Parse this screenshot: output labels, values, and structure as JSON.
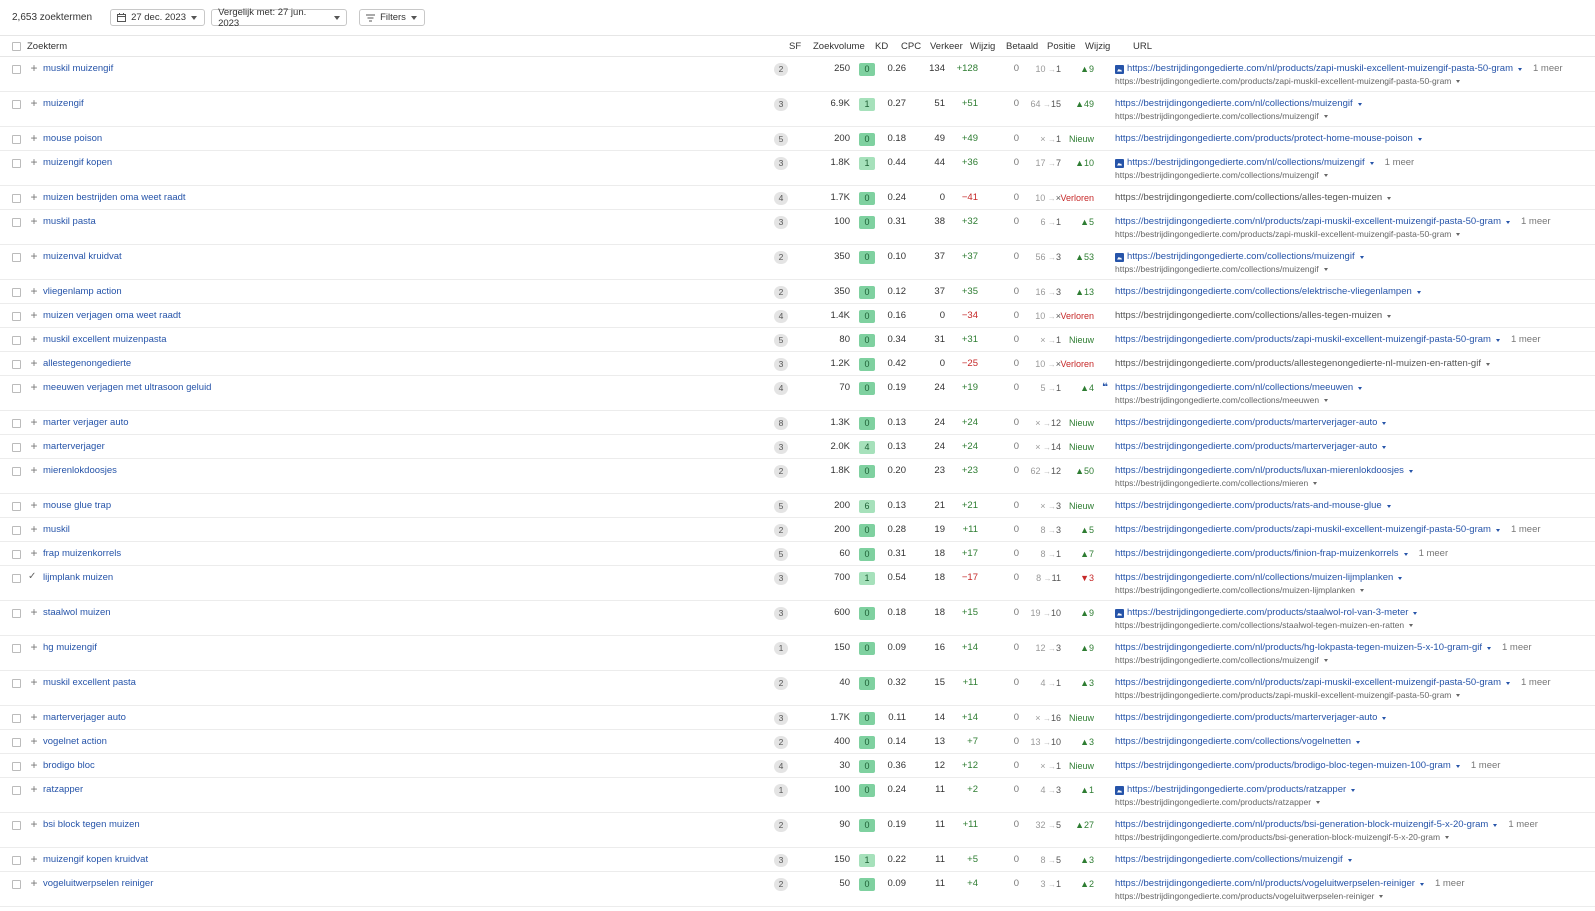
{
  "toolbar": {
    "count": "2,653 zoektermen",
    "date_label": "27 dec. 2023",
    "compare_label": "Vergelijk met: 27 jun. 2023",
    "filters_label": "Filters"
  },
  "table": {
    "headers": {
      "keyword": "Zoekterm",
      "sf": "SF",
      "volume": "Zoekvolume",
      "kd": "KD",
      "cpc": "CPC",
      "traffic": "Verkeer",
      "change": "Wijzig",
      "paid": "Betaald",
      "position": "Positie",
      "pos_change": "Wijzig",
      "url": "URL"
    },
    "more_label": "1 meer",
    "colors": {
      "kd_green": "#7fd1a0",
      "kd_light": "#a6e1bb",
      "link": "#2654a9",
      "up": "#2e7d32",
      "down": "#c62828"
    },
    "rows": [
      {
        "kw": "muskil muizengif",
        "sf": "2",
        "vol": "250",
        "kd": "0",
        "cpc": "0.26",
        "trf": "134",
        "chg": "+128",
        "paid": "0",
        "p_old": "10",
        "p_new": "1",
        "pc": "▲9",
        "pct": "up",
        "url1": "https://bestrijdingongedierte.com/nl/products/zapi-muskil-excellent-muizengif-pasta-50-gram",
        "img": true,
        "more": true,
        "url2": "https://bestrijdingongedierte.com/products/zapi-muskil-excellent-muizengif-pasta-50-gram"
      },
      {
        "kw": "muizengif",
        "sf": "3",
        "vol": "6.9K",
        "kd": "1",
        "cpc": "0.27",
        "trf": "51",
        "chg": "+51",
        "paid": "0",
        "p_old": "64",
        "p_new": "15",
        "pc": "▲49",
        "pct": "up",
        "url1": "https://bestrijdingongedierte.com/nl/collections/muizengif",
        "url2": "https://bestrijdingongedierte.com/collections/muizengif"
      },
      {
        "kw": "mouse poison",
        "sf": "5",
        "vol": "200",
        "kd": "0",
        "cpc": "0.18",
        "trf": "49",
        "chg": "+49",
        "paid": "0",
        "p_old": "×",
        "p_new": "1",
        "pc": "Nieuw",
        "pct": "up",
        "url1": "https://bestrijdingongedierte.com/products/protect-home-mouse-poison"
      },
      {
        "kw": "muizengif kopen",
        "sf": "3",
        "vol": "1.8K",
        "kd": "1",
        "cpc": "0.44",
        "trf": "44",
        "chg": "+36",
        "paid": "0",
        "p_old": "17",
        "p_new": "7",
        "pc": "▲10",
        "pct": "up",
        "url1": "https://bestrijdingongedierte.com/nl/collections/muizengif",
        "img": true,
        "more": true,
        "url2": "https://bestrijdingongedierte.com/collections/muizengif"
      },
      {
        "kw": "muizen bestrijden oma weet raadt",
        "sf": "4",
        "vol": "1.7K",
        "kd": "0",
        "cpc": "0.24",
        "trf": "0",
        "chg": "−41",
        "paid": "0",
        "p_old": "10",
        "p_new": "×",
        "pc": "Verloren",
        "pct": "down",
        "url1": "https://bestrijdingongedierte.com/collections/alles-tegen-muizen",
        "grey": true
      },
      {
        "kw": "muskil pasta",
        "sf": "3",
        "vol": "100",
        "kd": "0",
        "cpc": "0.31",
        "trf": "38",
        "chg": "+32",
        "paid": "0",
        "p_old": "6",
        "p_new": "1",
        "pc": "▲5",
        "pct": "up",
        "url1": "https://bestrijdingongedierte.com/nl/products/zapi-muskil-excellent-muizengif-pasta-50-gram",
        "more": true,
        "url2": "https://bestrijdingongedierte.com/products/zapi-muskil-excellent-muizengif-pasta-50-gram"
      },
      {
        "kw": "muizenval kruidvat",
        "sf": "2",
        "vol": "350",
        "kd": "0",
        "cpc": "0.10",
        "trf": "37",
        "chg": "+37",
        "paid": "0",
        "p_old": "56",
        "p_new": "3",
        "pc": "▲53",
        "pct": "up",
        "url1": "https://bestrijdingongedierte.com/collections/muizengif",
        "img": true,
        "url2": "https://bestrijdingongedierte.com/collections/muizengif"
      },
      {
        "kw": "vliegenlamp action",
        "sf": "2",
        "vol": "350",
        "kd": "0",
        "cpc": "0.12",
        "trf": "37",
        "chg": "+35",
        "paid": "0",
        "p_old": "16",
        "p_new": "3",
        "pc": "▲13",
        "pct": "up",
        "url1": "https://bestrijdingongedierte.com/collections/elektrische-vliegenlampen"
      },
      {
        "kw": "muizen verjagen oma weet raadt",
        "sf": "4",
        "vol": "1.4K",
        "kd": "0",
        "cpc": "0.16",
        "trf": "0",
        "chg": "−34",
        "paid": "0",
        "p_old": "10",
        "p_new": "×",
        "pc": "Verloren",
        "pct": "down",
        "url1": "https://bestrijdingongedierte.com/collections/alles-tegen-muizen",
        "grey": true
      },
      {
        "kw": "muskil excellent muizenpasta",
        "sf": "5",
        "vol": "80",
        "kd": "0",
        "cpc": "0.34",
        "trf": "31",
        "chg": "+31",
        "paid": "0",
        "p_old": "×",
        "p_new": "1",
        "pc": "Nieuw",
        "pct": "up",
        "url1": "https://bestrijdingongedierte.com/products/zapi-muskil-excellent-muizengif-pasta-50-gram",
        "more": true
      },
      {
        "kw": "allestegenongedierte",
        "sf": "3",
        "vol": "1.2K",
        "kd": "0",
        "cpc": "0.42",
        "trf": "0",
        "chg": "−25",
        "paid": "0",
        "p_old": "10",
        "p_new": "×",
        "pc": "Verloren",
        "pct": "down",
        "url1": "https://bestrijdingongedierte.com/products/allestegenongedierte-nl-muizen-en-ratten-gif",
        "grey": true
      },
      {
        "kw": "meeuwen verjagen met ultrasoon geluid",
        "sf": "4",
        "vol": "70",
        "kd": "0",
        "cpc": "0.19",
        "trf": "24",
        "chg": "+19",
        "paid": "0",
        "p_old": "5",
        "p_new": "1",
        "pc": "▲4",
        "pct": "up",
        "url1": "https://bestrijdingongedierte.com/nl/collections/meeuwen",
        "quote": true,
        "url2": "https://bestrijdingongedierte.com/collections/meeuwen"
      },
      {
        "kw": "marter verjager auto",
        "sf": "8",
        "vol": "1.3K",
        "kd": "0",
        "cpc": "0.13",
        "trf": "24",
        "chg": "+24",
        "paid": "0",
        "p_old": "×",
        "p_new": "12",
        "pc": "Nieuw",
        "pct": "up",
        "url1": "https://bestrijdingongedierte.com/products/marterverjager-auto"
      },
      {
        "kw": "marterverjager",
        "sf": "3",
        "vol": "2.0K",
        "kd": "4",
        "cpc": "0.13",
        "trf": "24",
        "chg": "+24",
        "paid": "0",
        "p_old": "×",
        "p_new": "14",
        "pc": "Nieuw",
        "pct": "up",
        "url1": "https://bestrijdingongedierte.com/products/marterverjager-auto"
      },
      {
        "kw": "mierenlokdoosjes",
        "sf": "2",
        "vol": "1.8K",
        "kd": "0",
        "cpc": "0.20",
        "trf": "23",
        "chg": "+23",
        "paid": "0",
        "p_old": "62",
        "p_new": "12",
        "pc": "▲50",
        "pct": "up",
        "url1": "https://bestrijdingongedierte.com/nl/products/luxan-mierenlokdoosjes",
        "url2": "https://bestrijdingongedierte.com/collections/mieren"
      },
      {
        "kw": "mouse glue trap",
        "sf": "5",
        "vol": "200",
        "kd": "6",
        "cpc": "0.13",
        "trf": "21",
        "chg": "+21",
        "paid": "0",
        "p_old": "×",
        "p_new": "3",
        "pc": "Nieuw",
        "pct": "up",
        "url1": "https://bestrijdingongedierte.com/products/rats-and-mouse-glue"
      },
      {
        "kw": "muskil",
        "sf": "2",
        "vol": "200",
        "kd": "0",
        "cpc": "0.28",
        "trf": "19",
        "chg": "+11",
        "paid": "0",
        "p_old": "8",
        "p_new": "3",
        "pc": "▲5",
        "pct": "up",
        "url1": "https://bestrijdingongedierte.com/products/zapi-muskil-excellent-muizengif-pasta-50-gram",
        "more": true
      },
      {
        "kw": "frap muizenkorrels",
        "sf": "5",
        "vol": "60",
        "kd": "0",
        "cpc": "0.31",
        "trf": "18",
        "chg": "+17",
        "paid": "0",
        "p_old": "8",
        "p_new": "1",
        "pc": "▲7",
        "pct": "up",
        "url1": "https://bestrijdingongedierte.com/products/finion-frap-muizenkorrels",
        "more": true
      },
      {
        "kw": "lijmplank muizen",
        "sf": "3",
        "vol": "700",
        "kd": "1",
        "cpc": "0.54",
        "trf": "18",
        "chg": "−17",
        "paid": "0",
        "p_old": "8",
        "p_new": "11",
        "pc": "▼3",
        "pct": "down",
        "url1": "https://bestrijdingongedierte.com/nl/collections/muizen-lijmplanken",
        "tick": true,
        "url2": "https://bestrijdingongedierte.com/collections/muizen-lijmplanken"
      },
      {
        "kw": "staalwol muizen",
        "sf": "3",
        "vol": "600",
        "kd": "0",
        "cpc": "0.18",
        "trf": "18",
        "chg": "+15",
        "paid": "0",
        "p_old": "19",
        "p_new": "10",
        "pc": "▲9",
        "pct": "up",
        "url1": "https://bestrijdingongedierte.com/products/staalwol-rol-van-3-meter",
        "img": true,
        "url2": "https://bestrijdingongedierte.com/collections/staalwol-tegen-muizen-en-ratten"
      },
      {
        "kw": "hg muizengif",
        "sf": "1",
        "vol": "150",
        "kd": "0",
        "cpc": "0.09",
        "trf": "16",
        "chg": "+14",
        "paid": "0",
        "p_old": "12",
        "p_new": "3",
        "pc": "▲9",
        "pct": "up",
        "url1": "https://bestrijdingongedierte.com/nl/products/hg-lokpasta-tegen-muizen-5-x-10-gram-gif",
        "more": true,
        "url2": "https://bestrijdingongedierte.com/collections/muizengif"
      },
      {
        "kw": "muskil excellent pasta",
        "sf": "2",
        "vol": "40",
        "kd": "0",
        "cpc": "0.32",
        "trf": "15",
        "chg": "+11",
        "paid": "0",
        "p_old": "4",
        "p_new": "1",
        "pc": "▲3",
        "pct": "up",
        "url1": "https://bestrijdingongedierte.com/nl/products/zapi-muskil-excellent-muizengif-pasta-50-gram",
        "more": true,
        "url2": "https://bestrijdingongedierte.com/products/zapi-muskil-excellent-muizengif-pasta-50-gram"
      },
      {
        "kw": "marterverjager auto",
        "sf": "3",
        "vol": "1.7K",
        "kd": "0",
        "cpc": "0.11",
        "trf": "14",
        "chg": "+14",
        "paid": "0",
        "p_old": "×",
        "p_new": "16",
        "pc": "Nieuw",
        "pct": "up",
        "url1": "https://bestrijdingongedierte.com/products/marterverjager-auto"
      },
      {
        "kw": "vogelnet action",
        "sf": "2",
        "vol": "400",
        "kd": "0",
        "cpc": "0.14",
        "trf": "13",
        "chg": "+7",
        "paid": "0",
        "p_old": "13",
        "p_new": "10",
        "pc": "▲3",
        "pct": "up",
        "url1": "https://bestrijdingongedierte.com/collections/vogelnetten"
      },
      {
        "kw": "brodigo bloc",
        "sf": "4",
        "vol": "30",
        "kd": "0",
        "cpc": "0.36",
        "trf": "12",
        "chg": "+12",
        "paid": "0",
        "p_old": "×",
        "p_new": "1",
        "pc": "Nieuw",
        "pct": "up",
        "url1": "https://bestrijdingongedierte.com/products/brodigo-bloc-tegen-muizen-100-gram",
        "more": true
      },
      {
        "kw": "ratzapper",
        "sf": "1",
        "vol": "100",
        "kd": "0",
        "cpc": "0.24",
        "trf": "11",
        "chg": "+2",
        "paid": "0",
        "p_old": "4",
        "p_new": "3",
        "pc": "▲1",
        "pct": "up",
        "url1": "https://bestrijdingongedierte.com/products/ratzapper",
        "img": true,
        "url2": "https://bestrijdingongedierte.com/products/ratzapper"
      },
      {
        "kw": "bsi block tegen muizen",
        "sf": "2",
        "vol": "90",
        "kd": "0",
        "cpc": "0.19",
        "trf": "11",
        "chg": "+11",
        "paid": "0",
        "p_old": "32",
        "p_new": "5",
        "pc": "▲27",
        "pct": "up",
        "url1": "https://bestrijdingongedierte.com/nl/products/bsi-generation-block-muizengif-5-x-20-gram",
        "more": true,
        "url2": "https://bestrijdingongedierte.com/products/bsi-generation-block-muizengif-5-x-20-gram"
      },
      {
        "kw": "muizengif kopen kruidvat",
        "sf": "3",
        "vol": "150",
        "kd": "1",
        "cpc": "0.22",
        "trf": "11",
        "chg": "+5",
        "paid": "0",
        "p_old": "8",
        "p_new": "5",
        "pc": "▲3",
        "pct": "up",
        "url1": "https://bestrijdingongedierte.com/collections/muizengif"
      },
      {
        "kw": "vogeluitwerpselen reiniger",
        "sf": "2",
        "vol": "50",
        "kd": "0",
        "cpc": "0.09",
        "trf": "11",
        "chg": "+4",
        "paid": "0",
        "p_old": "3",
        "p_new": "1",
        "pc": "▲2",
        "pct": "up",
        "url1": "https://bestrijdingongedierte.com/nl/products/vogeluitwerpselen-reiniger",
        "more": true,
        "url2": "https://bestrijdingongedierte.com/products/vogeluitwerpselen-reiniger"
      }
    ]
  }
}
